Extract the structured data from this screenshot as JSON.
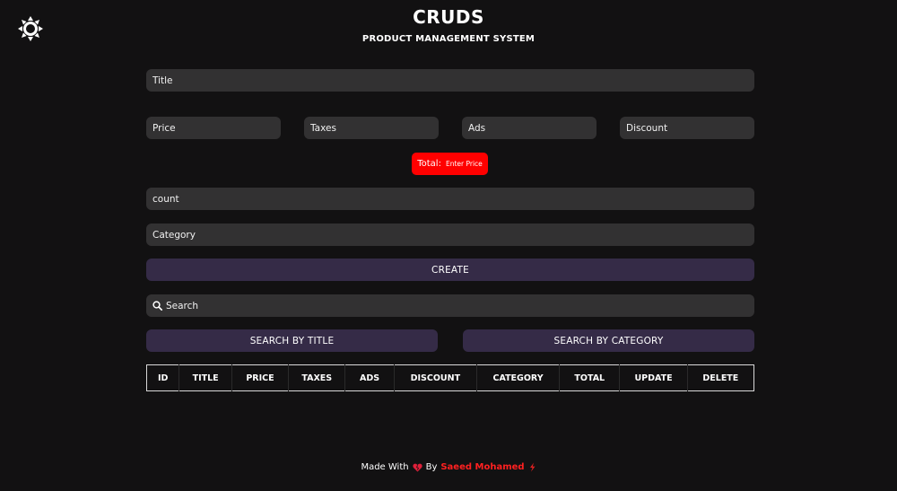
{
  "header": {
    "title": "CRUDS",
    "subtitle": "PRODUCT MANAGEMENT SYSTEM"
  },
  "theme_toggle": {
    "icon": "sun-icon"
  },
  "form": {
    "title_placeholder": "Title",
    "price_placeholder": "Price",
    "taxes_placeholder": "Taxes",
    "ads_placeholder": "Ads",
    "discount_placeholder": "Discount",
    "total_label": "Total:",
    "total_value": "Enter Price",
    "count_placeholder": "count",
    "category_placeholder": "Category",
    "create_label": "CREATE"
  },
  "search": {
    "icon": "search-icon",
    "placeholder": "Search",
    "by_title_label": "SEARCH BY TITLE",
    "by_category_label": "SEARCH BY CATEGORY"
  },
  "table": {
    "columns": [
      "ID",
      "TITLE",
      "PRICE",
      "TAXES",
      "ADS",
      "DISCOUNT",
      "CATEGORY",
      "TOTAL",
      "UPDATE",
      "DELETE"
    ]
  },
  "footer": {
    "made_with": "Made With",
    "heart_icon": "heart-icon",
    "by": "By",
    "author": "Saeed Mohamed",
    "bolt_icon": "lightning-icon"
  },
  "colors": {
    "background": "#121112",
    "input": "#323132",
    "button": "#352b47",
    "total_badge": "#ff0000",
    "author": "#ff2020"
  }
}
